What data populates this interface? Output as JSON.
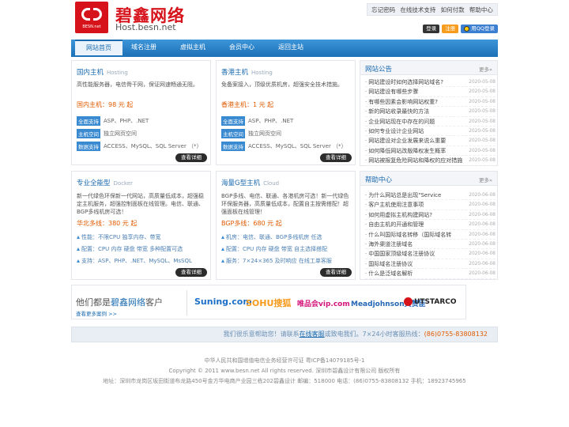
{
  "logo": {
    "cn": "碧鑫网络",
    "en": "Host.besn.net",
    "small": "BESN.net"
  },
  "top_links": [
    "忘记密码",
    "在线技术支持",
    "如何付款",
    "帮助中心"
  ],
  "auth": {
    "login": "登录",
    "register": "注册",
    "qq_login": "用QQ登录"
  },
  "nav": [
    "网站首页",
    "域名注册",
    "虚拟主机",
    "会员中心",
    "返回主站"
  ],
  "cards": [
    {
      "title": "国内主机",
      "en": "Hosting",
      "desc": "高性能服务器，电信骨干网，保证网速畅通无阻。",
      "price": "国内主机：98 元 起",
      "tags": [
        {
          "tag": "全面支持",
          "text": "ASP、PHP、.NET"
        },
        {
          "tag": "主机空间",
          "text": "独立网页空间"
        },
        {
          "tag": "数据支持",
          "text": "ACCESS、MySQL、SQL Server （*）"
        }
      ],
      "more": "查看详细"
    },
    {
      "title": "香港主机",
      "en": "Hosting",
      "desc": "免备案接入，顶级优质机房，超强安全技术措施。",
      "price": "香港主机：1 元 起",
      "tags": [
        {
          "tag": "全面支持",
          "text": "ASP、PHP、.NET"
        },
        {
          "tag": "主机空间",
          "text": "独立网页空间"
        },
        {
          "tag": "数据支持",
          "text": "ACCESS、MySQL、SQL Server （*）"
        }
      ],
      "more": "查看详细"
    },
    {
      "title": "专业全能型",
      "en": "Docker",
      "desc": "新一代绿色环保新一代网站，高质量低成本，超强稳定主机服务，超强控制面板在线管理。电信、联通、BGP多线机房可选！",
      "price": "华北多线：380 元 起",
      "feats": [
        "性能：不限CPU 独享内存、带宽",
        "配置：CPU 内存 硬盘 带宽 多种配置可选",
        "支持：ASP、PHP、.NET、MySQL、MsSQL"
      ],
      "more": "查看详细"
    },
    {
      "title": "海量G型主机",
      "en": "Cloud",
      "desc": "BGP多线、电信、联通、各港机房可选！新一代绿色环保服务器，高质量低成本，配置自主按需搭配！超强面板在线管理！",
      "price": "BGP多线：680 元 起",
      "feats": [
        "机房：电信、联通、BGP多线机房 任选",
        "配置：CPU 内存 硬盘 带宽 自主选择搭配",
        "服务：7×24×365 及时响应 在线工单客服"
      ],
      "more": "查看详细"
    }
  ],
  "notice": {
    "title": "网站公告",
    "more": "更多»",
    "items": [
      {
        "t": "网站建设时如何选择网站域名?",
        "d": "2020-05-08"
      },
      {
        "t": "网站建设有哪些步骤",
        "d": "2020-05-08"
      },
      {
        "t": "有哪些因素会影响网站权重?",
        "d": "2020-05-08"
      },
      {
        "t": "新的网站收录最快的方法",
        "d": "2020-05-08"
      },
      {
        "t": "企业网站现在中存在的问题",
        "d": "2020-05-08"
      },
      {
        "t": "如何专业设计企业网站",
        "d": "2020-05-08"
      },
      {
        "t": "网站建设对企业发展来说么重要",
        "d": "2020-05-08"
      },
      {
        "t": "如何降低网站改版降权发生概率",
        "d": "2020-05-08"
      },
      {
        "t": "网站被报复危险网站和降权的应对措施",
        "d": "2020-05-08"
      }
    ]
  },
  "help": {
    "title": "帮助中心",
    "more": "更多»",
    "items": [
      {
        "t": "为什么网站总是出现\"Service",
        "d": "2020-06-08"
      },
      {
        "t": "客户主机使用注意事项",
        "d": "2020-06-08"
      },
      {
        "t": "如何用虚拟主机构建网站?",
        "d": "2020-06-08"
      },
      {
        "t": "自由主机的开通和管理",
        "d": "2020-06-08"
      },
      {
        "t": "什么叫国际域名转移（国际域名转",
        "d": "2020-06-08"
      },
      {
        "t": "海外渠道注册域名",
        "d": "2020-06-08"
      },
      {
        "t": "中国国家顶级域名注册协议",
        "d": "2020-06-08"
      },
      {
        "t": "国际域名注册协议",
        "d": "2020-06-08"
      },
      {
        "t": "什么是泛域名解析",
        "d": "2020-06-08"
      }
    ]
  },
  "clients": {
    "prefix": "他们都是",
    "brand": "碧鑫网络",
    "suffix": "客户",
    "more": "查看更多案例 >>",
    "logos": [
      "Suning.com",
      "SOHU搜狐",
      "唯品会vip.com",
      "Meadjohnson美赞臣",
      "UTSTARCO"
    ]
  },
  "support": {
    "a": "我们很乐意帮助您！请联系",
    "link": "在线客服",
    "b": "或致电我们。7×24小时客服热线：",
    "phone": "(86)0755-83808132"
  },
  "footer": [
    "中华人民共和国增值电信业务经营许可证 粤ICP备14079185号-1",
    "Copyright © 2011 www.besn.net All rights reserved. 深圳市碧鑫设计有限公司 版权所有",
    "地址：深圳市龙岗区坂田街道布龙路450号金方华电商产业园三栋202碧鑫设计 邮编：518000 电话：(86)0755-83808132 手机：18923745965"
  ]
}
